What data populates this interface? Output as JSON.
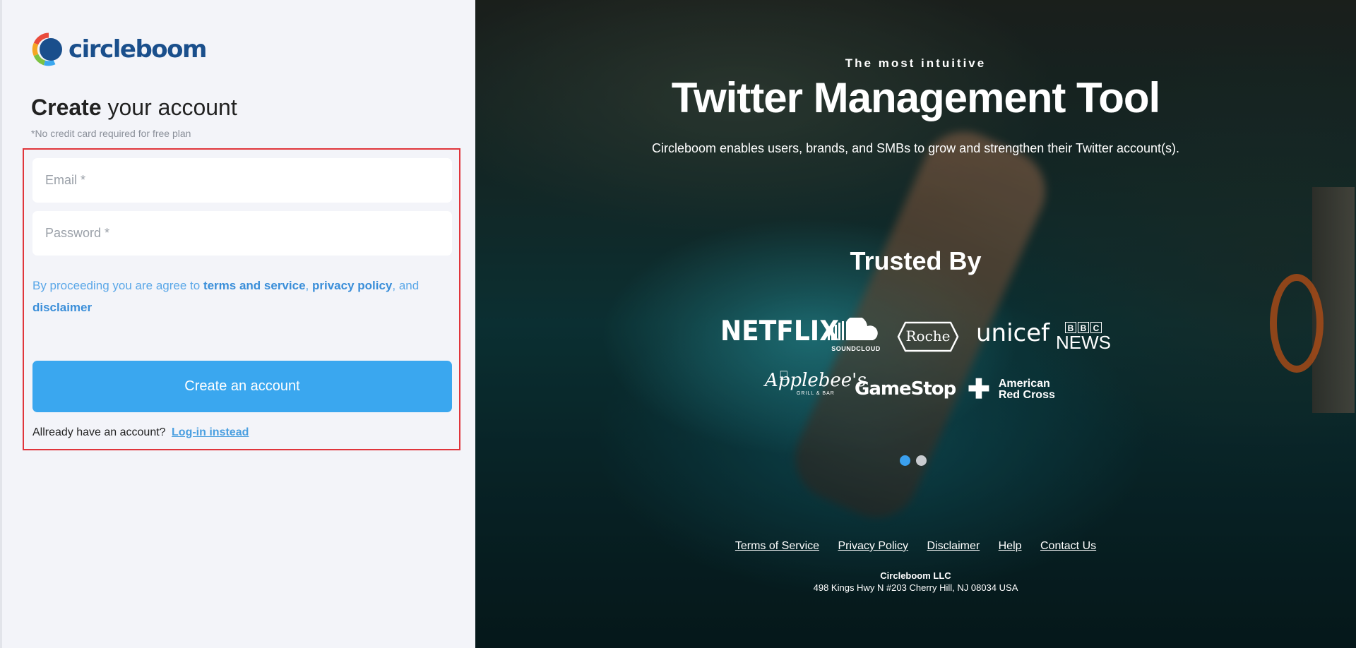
{
  "brand": {
    "logo_text": "circleboom"
  },
  "signup": {
    "heading_bold": "Create",
    "heading_rest": "your account",
    "subnote": "*No credit card required for free plan",
    "email_placeholder": "Email *",
    "password_placeholder": "Password *",
    "terms_prefix": "By proceeding you are agree to ",
    "terms_link": "terms and service",
    "terms_sep1": ", ",
    "privacy_link": "privacy policy",
    "terms_sep2": ", and ",
    "disclaimer_link": "disclaimer",
    "create_button": "Create an account",
    "login_prompt": "Allready have an account?",
    "login_link": "Log-in instead"
  },
  "hero": {
    "tagline": "The most intuitive",
    "title": "Twitter Management Tool",
    "description": "Circleboom enables users, brands, and SMBs to grow and strengthen their Twitter account(s).",
    "trusted_heading": "Trusted By",
    "brands": {
      "netflix": "NETFLIX",
      "soundcloud": "SOUNDCLOUD",
      "roche": "Roche",
      "unicef": "unicef",
      "bbc_letters": [
        "B",
        "B",
        "C"
      ],
      "bbc_news": "NEWS",
      "applebees": "Applebee's",
      "applebees_sub": "GRILL & BAR",
      "gamestop": "GameStop",
      "redcross_line1": "American",
      "redcross_line2": "Red Cross"
    },
    "carousel": {
      "active_index": 0,
      "count": 2,
      "active_color": "#3aa0ee",
      "inactive_color": "#c8ccd0"
    }
  },
  "footer": {
    "links": [
      "Terms of Service",
      "Privacy Policy",
      "Disclaimer",
      "Help",
      "Contact Us"
    ],
    "company": "Circleboom LLC",
    "address": "498 Kings Hwy N #203 Cherry Hill, NJ 08034 USA"
  },
  "colors": {
    "primary_button": "#3aa7ef",
    "link": "#3a8ed9",
    "highlight_border": "#e0353b",
    "logo_text": "#1a4f8c"
  }
}
